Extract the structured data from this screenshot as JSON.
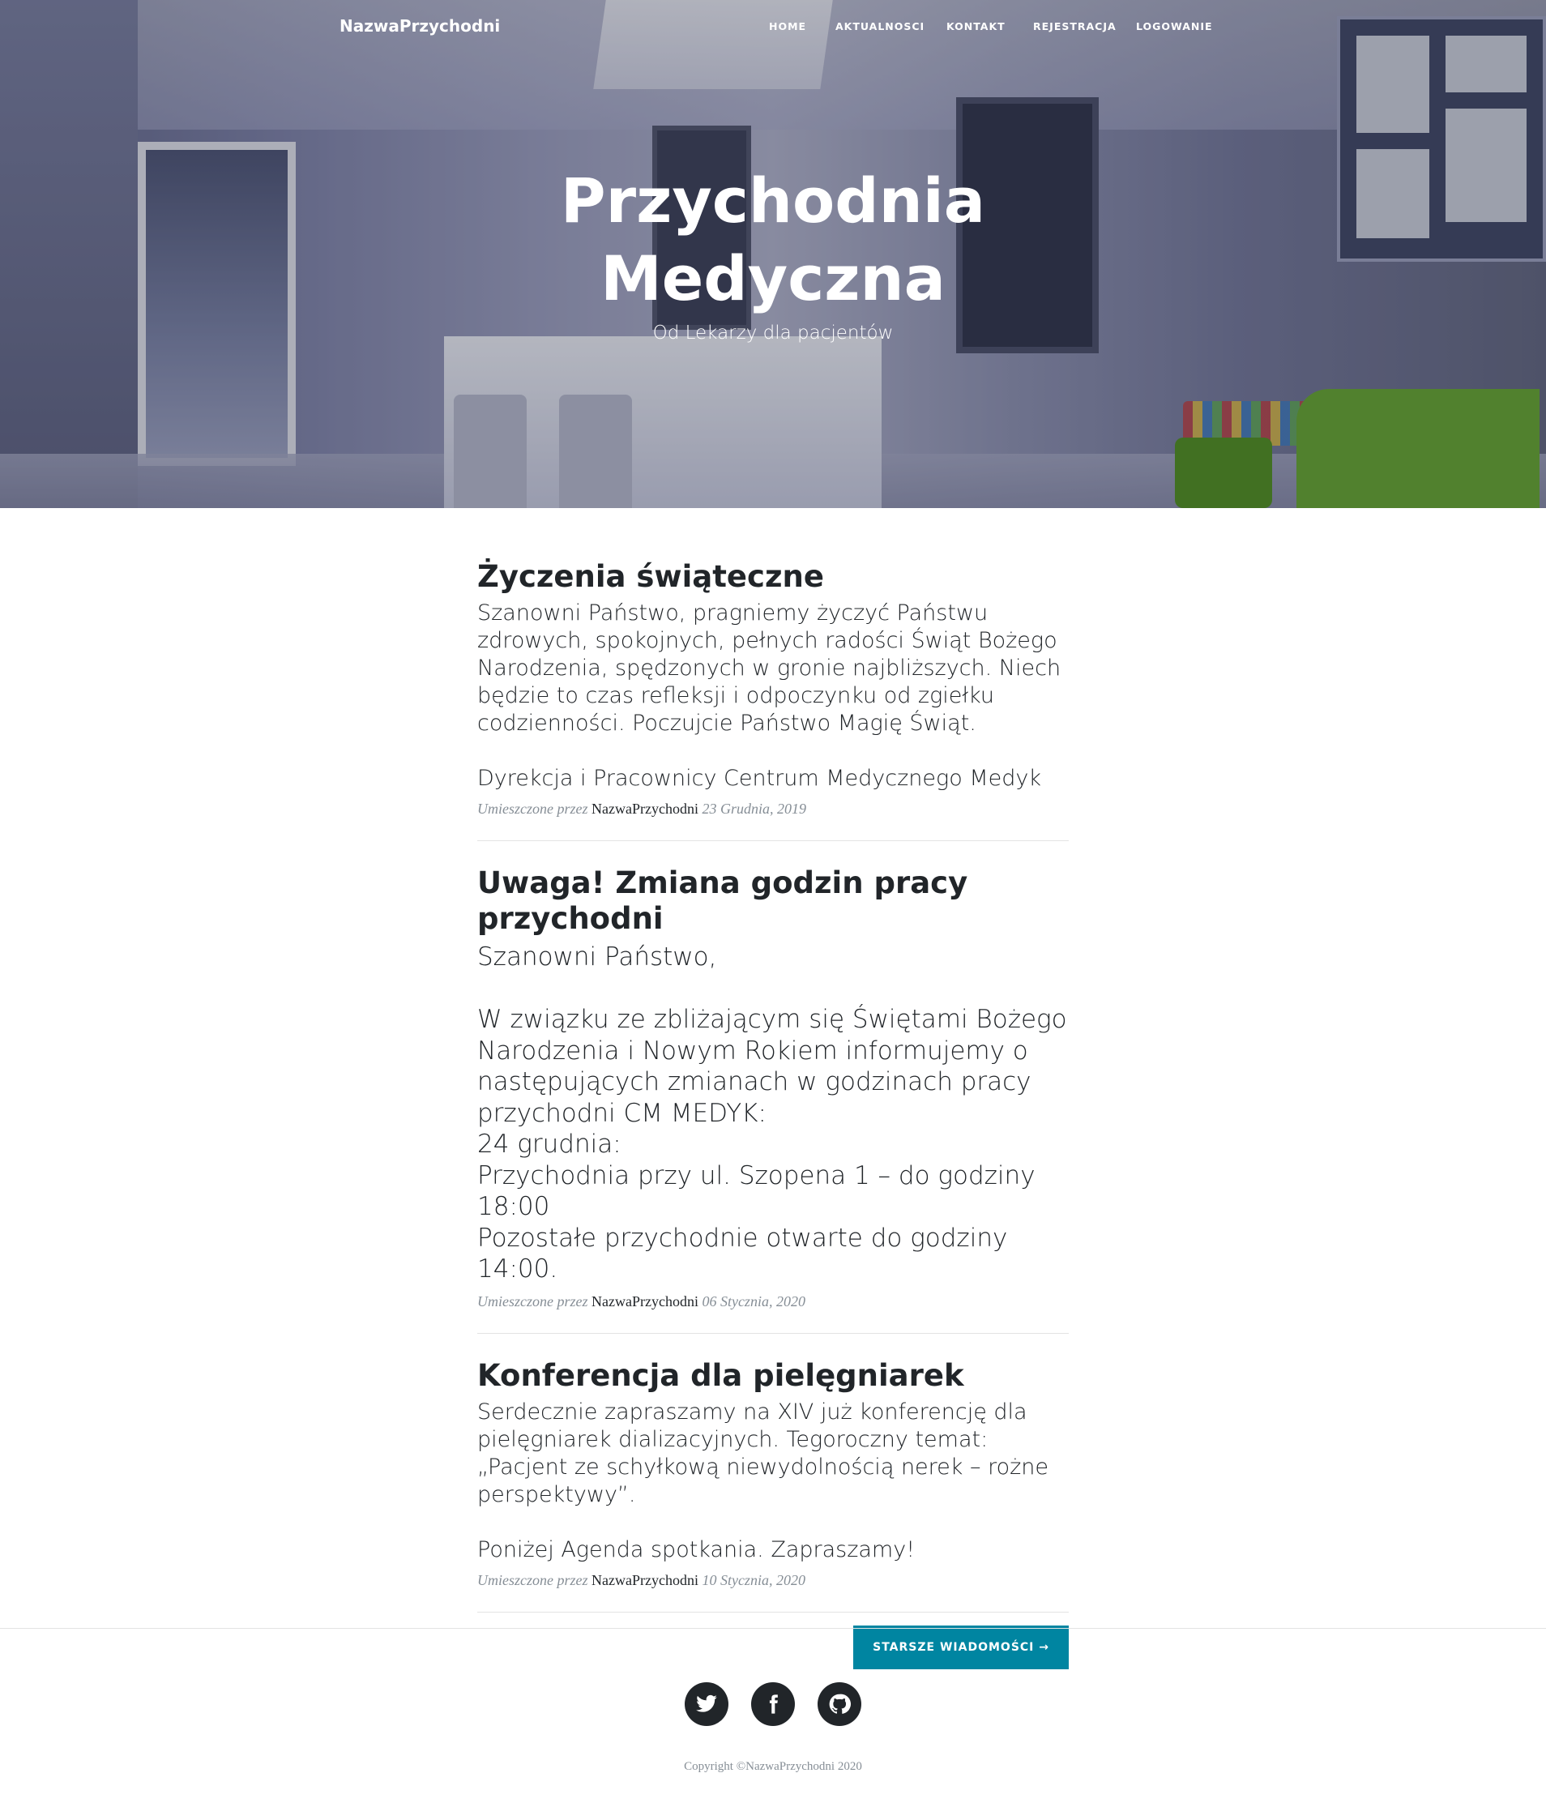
{
  "navbar": {
    "brand": "NazwaPrzychodni",
    "links": [
      "HOME",
      "AKTUALNOSCI",
      "KONTAKT",
      "REJESTRACJA",
      "LOGOWANIE"
    ]
  },
  "hero": {
    "title_line1": "Przychodnia",
    "title_line2": "Medyczna",
    "subtitle": "Od Lekarzy dla pacjentów"
  },
  "posts": [
    {
      "title": "Życzenia świąteczne",
      "body": "Szanowni Państwo, pragniemy życzyć Państwu zdrowych, spokojnych, pełnych radości Świąt Bożego Narodzenia, spędzonych w gronie najbliższych. Niech będzie to czas refleksji i odpoczynku od zgiełku codzienności. Poczujcie Państwo Magię Świąt.\n\nDyrekcja i Pracownicy Centrum Medycznego Medyk",
      "meta_prefix": "Umieszczone przez",
      "author": "NazwaPrzychodni",
      "date": "23 Grudnia, 2019"
    },
    {
      "title": "Uwaga! Zmiana godzin pracy przychodni",
      "body": "Szanowni Państwo,\n\nW związku ze zbliżającym się Świętami Bożego Narodzenia i Nowym Rokiem informujemy o następujących zmianach w godzinach pracy przychodni CM MEDYK:\n24 grudnia:\nPrzychodnia przy ul. Szopena 1 – do godziny 18:00\nPozostałe przychodnie otwarte do godziny 14:00.",
      "meta_prefix": "Umieszczone przez",
      "author": "NazwaPrzychodni",
      "date": "06 Stycznia, 2020"
    },
    {
      "title": "Konferencja dla pielęgniarek",
      "body": "Serdecznie zapraszamy na XIV już konferencję dla pielęgniarek dializacyjnych. Tegoroczny temat: „Pacjent ze schyłkową niewydolnością nerek – rożne perspektywy”.\n\nPoniżej Agenda spotkania. Zapraszamy!",
      "meta_prefix": "Umieszczone przez",
      "author": "NazwaPrzychodni",
      "date": "10 Stycznia, 2020"
    }
  ],
  "pager": {
    "older_label": "STARSZE WIADOMOŚCI →"
  },
  "footer": {
    "social_icons": [
      "twitter-icon",
      "facebook-icon",
      "github-icon"
    ],
    "copyright": "Copyright ©NazwaPrzychodni 2020"
  },
  "colors": {
    "accent": "#0085a1",
    "text": "#212529",
    "muted": "#868e96"
  }
}
